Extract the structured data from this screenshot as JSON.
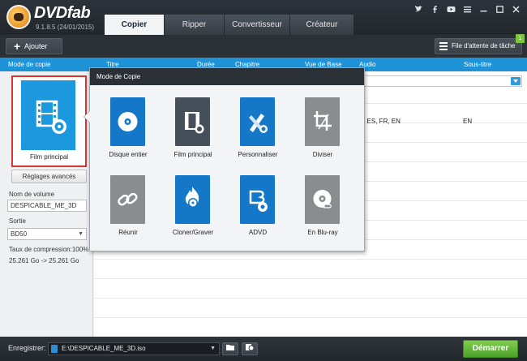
{
  "app": {
    "brand": "DVDfab",
    "version": "9.1.8.5 (24/01/2015)"
  },
  "tabs": [
    {
      "label": "Copier",
      "active": true
    },
    {
      "label": "Ripper",
      "active": false
    },
    {
      "label": "Convertisseur",
      "active": false
    },
    {
      "label": "Créateur",
      "active": false
    }
  ],
  "window_icons": [
    "twitter-icon",
    "facebook-icon",
    "youtube-icon",
    "menu-icon",
    "minimize-icon",
    "maximize-icon",
    "close-icon"
  ],
  "toolbar": {
    "add_label": "Ajouter",
    "queue_label": "File d'attente de tâche",
    "queue_count": "1"
  },
  "columns": [
    "Mode de copie",
    "Titre",
    "Durée",
    "Chapitre",
    "Vue de Base",
    "Audio",
    "Sous-titre"
  ],
  "left_panel": {
    "mode_label": "Film principal",
    "advanced_button": "Réglages avancés",
    "volume_label": "Nom de volume",
    "volume_value": "DESPICABLE_ME_3D",
    "output_label": "Sortie",
    "output_value": "BD50",
    "compression_text": "Taux de compression:100%",
    "size_text": "25.261 Go -> 25.261 Go"
  },
  "content": {
    "audio_value": "EN, ES, FR, EN",
    "subtitle_value": "EN"
  },
  "popup": {
    "title": "Mode de Copie",
    "items": [
      {
        "label": "Disque entier",
        "icon": "disc-icon",
        "style": "blue"
      },
      {
        "label": "Film principal",
        "icon": "film-icon",
        "style": "dark"
      },
      {
        "label": "Personnaliser",
        "icon": "pencil-ruler-icon",
        "style": "blue"
      },
      {
        "label": "Diviser",
        "icon": "crop-icon",
        "style": "grey"
      },
      {
        "label": "Réunir",
        "icon": "link-icon",
        "style": "grey"
      },
      {
        "label": "Cloner/Graver",
        "icon": "flame-disc-icon",
        "style": "blue"
      },
      {
        "label": "ADVD",
        "icon": "bluray-disc-icon",
        "style": "blue"
      },
      {
        "label": "En Blu-ray",
        "icon": "bluray-convert-icon",
        "style": "grey"
      }
    ]
  },
  "bottom": {
    "save_label": "Enregistrer:",
    "path": "E:\\DESPICABLE_ME_3D.iso",
    "start_label": "Démarrer"
  }
}
